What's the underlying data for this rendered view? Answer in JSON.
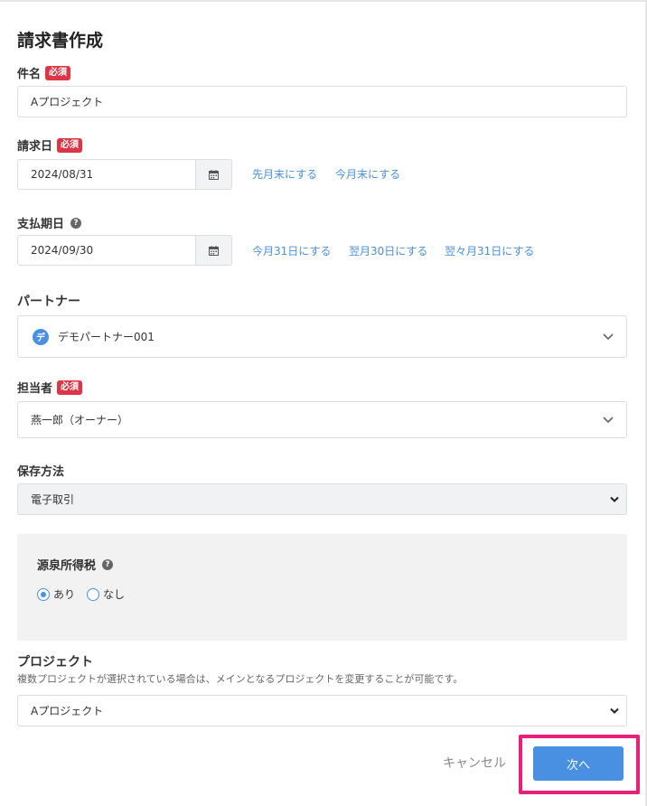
{
  "form": {
    "title": "請求書作成",
    "required_badge": "必須",
    "subject": {
      "label": "件名",
      "value": "Aプロジェクト"
    },
    "invoice_date": {
      "label": "請求日",
      "value": "2024/08/31",
      "quick_links": [
        "先月末にする",
        "今月末にする"
      ]
    },
    "due_date": {
      "label": "支払期日",
      "value": "2024/09/30",
      "quick_links": [
        "今月31日にする",
        "翌月30日にする",
        "翌々月31日にする"
      ]
    },
    "partner": {
      "label": "パートナー",
      "avatar_char": "デ",
      "value": "デモパートナー001"
    },
    "assignee": {
      "label": "担当者",
      "value": "燕一郎（オーナー）"
    },
    "storage": {
      "label": "保存方法",
      "value": "電子取引"
    },
    "withholding": {
      "label": "源泉所得税",
      "options": [
        {
          "label": "あり",
          "selected": true
        },
        {
          "label": "なし",
          "selected": false
        }
      ]
    },
    "project": {
      "label": "プロジェクト",
      "description": "複数プロジェクトが選択されている場合は、メインとなるプロジェクトを変更することが可能です。",
      "value": "Aプロジェクト"
    },
    "actions": {
      "cancel": "キャンセル",
      "next": "次へ"
    }
  },
  "colors": {
    "accent": "#4a90e2",
    "link": "#4a90d9",
    "required": "#dc3545",
    "highlight": "#e8207a"
  }
}
